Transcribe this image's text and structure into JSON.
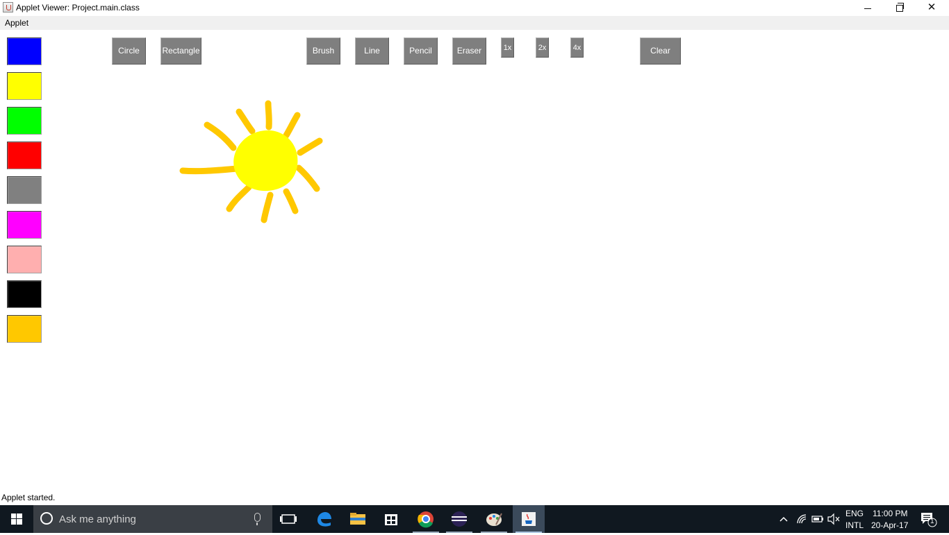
{
  "window": {
    "title": "Applet Viewer: Project.main.class"
  },
  "menubar": {
    "items": [
      "Applet"
    ]
  },
  "palette": {
    "colors": [
      "#0000ff",
      "#ffff00",
      "#00ff00",
      "#ff0000",
      "#808080",
      "#ff00ff",
      "#ffafaf",
      "#000000",
      "#ffc800"
    ],
    "names": [
      "blue",
      "yellow",
      "green",
      "red",
      "gray",
      "magenta",
      "pink",
      "black",
      "orange"
    ]
  },
  "toolbar": {
    "circle": "Circle",
    "rectangle": "Rectangle",
    "brush": "Brush",
    "line": "Line",
    "pencil": "Pencil",
    "eraser": "Eraser",
    "size1": "1x",
    "size2": "2x",
    "size4": "4x",
    "clear": "Clear"
  },
  "drawing": {
    "sun_body_color": "#ffff00",
    "rays_color": "#ffc800"
  },
  "status": {
    "text": "Applet started."
  },
  "taskbar": {
    "search_placeholder": "Ask me anything",
    "apps": [
      "task-view-icon",
      "edge-icon",
      "file-explorer-icon",
      "store-icon",
      "chrome-icon",
      "eclipse-icon",
      "paint-icon",
      "java-icon"
    ],
    "lang_top": "ENG",
    "lang_bottom": "INTL",
    "time": "11:00 PM",
    "date": "20-Apr-17",
    "notification_count": "1"
  }
}
